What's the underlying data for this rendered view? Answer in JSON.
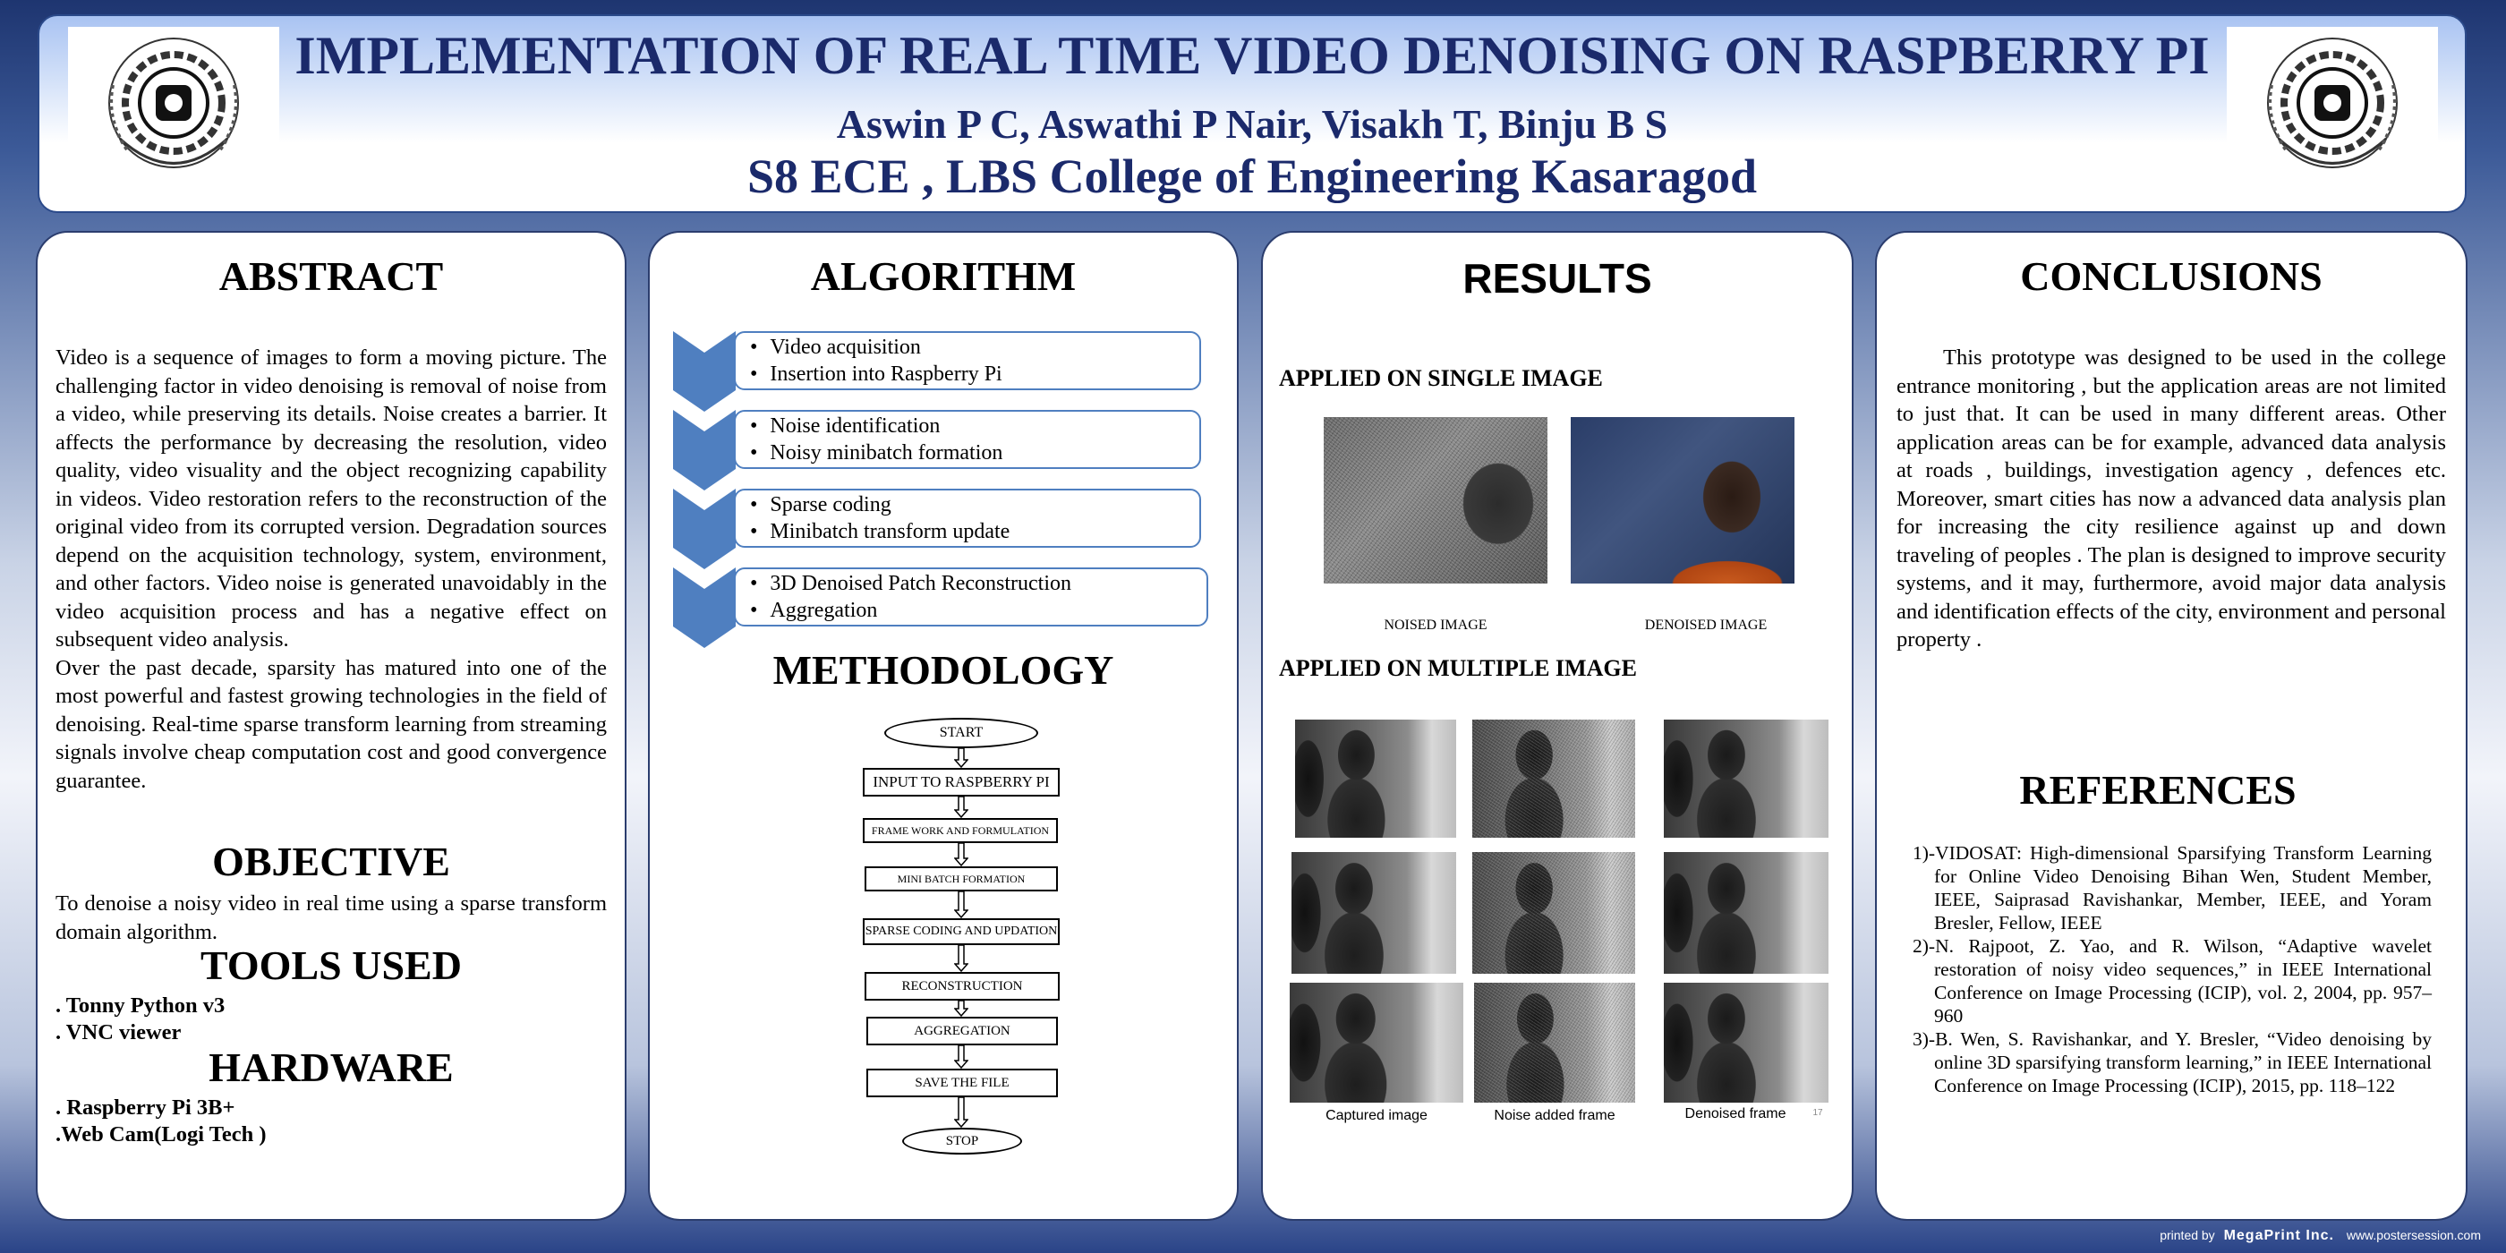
{
  "header": {
    "title": "IMPLEMENTATION OF REAL TIME VIDEO DENOISING ON RASPBERRY PI",
    "authors": "Aswin P C,  Aswathi P Nair, Visakh T,  Binju B S",
    "college": "S8 ECE , LBS College of Engineering Kasaragod"
  },
  "abstract": {
    "title": "ABSTRACT",
    "para1": "Video is a sequence of images to form a moving picture. The challenging factor in video denoising is removal of noise from a video, while preserving its details. Noise creates a barrier. It affects the performance by decreasing the resolution, video quality, video visuality and the object recognizing capability in videos. Video restoration refers to the reconstruction of the original video from its corrupted version. Degradation sources depend on the acquisition technology, system, environment, and other factors. Video noise is generated unavoidably in the video acquisition process and has a negative effect on subsequent video analysis.",
    "para2": "Over the past decade, sparsity has matured into one of the most powerful and fastest growing technologies in the field of denoising. Real-time sparse transform learning from streaming signals involve cheap computation cost and good convergence guarantee."
  },
  "objective": {
    "title": "OBJECTIVE",
    "text": "To denoise a noisy video in real time using a sparse transform domain algorithm."
  },
  "tools": {
    "title": "TOOLS USED",
    "items": [
      ". Tonny Python v3",
      ". VNC viewer"
    ]
  },
  "hardware": {
    "title": "HARDWARE",
    "items": [
      ". Raspberry Pi 3B+",
      ".Web Cam(Logi Tech )"
    ]
  },
  "algorithm": {
    "title": "ALGORITHM",
    "steps": [
      [
        "Video acquisition",
        "Insertion into Raspberry Pi"
      ],
      [
        "Noise identification",
        "Noisy minibatch formation"
      ],
      [
        "Sparse coding",
        "Minibatch transform update"
      ],
      [
        "3D Denoised Patch Reconstruction",
        "Aggregation"
      ]
    ],
    "color": "#4f7fc0"
  },
  "methodology": {
    "title": "METHODOLOGY",
    "flow": [
      "START",
      "INPUT TO RASPBERRY PI",
      "FRAME WORK AND FORMULATION",
      "MINI BATCH FORMATION",
      "SPARSE CODING AND UPDATION",
      "RECONSTRUCTION",
      "AGGREGATION",
      "SAVE THE FILE",
      "STOP"
    ]
  },
  "results": {
    "title": "RESULTS",
    "single_heading": "APPLIED ON SINGLE IMAGE",
    "single_captions": [
      "NOISED IMAGE",
      "DENOISED IMAGE"
    ],
    "multiple_heading": "APPLIED ON MULTIPLE IMAGE",
    "multiple_captions": [
      "Captured image",
      "Noise added frame",
      "Denoised frame"
    ],
    "slide_number": "17"
  },
  "conclusions": {
    "title": "CONCLUSIONS",
    "text": "This prototype was designed to be used in the college entrance monitoring , but the application areas are not limited to just that. It can be used in many different areas. Other application areas can be for example, advanced data analysis at roads , buildings, investigation agency , defences etc. Moreover, smart cities has now a advanced data analysis  plan for increasing the city resilience against up and down traveling of peoples . The plan is designed to improve security systems, and it may, furthermore, avoid major data analysis and identification effects of the city, environment and personal property ."
  },
  "references": {
    "title": "REFERENCES",
    "items": [
      "1)-VIDOSAT: High-dimensional Sparsifying Transform Learning for Online Video Denoising Bihan Wen, Student Member, IEEE, Saiprasad Ravishankar, Member, IEEE, and Yoram Bresler, Fellow, IEEE",
      "2)-N. Rajpoot, Z. Yao, and R. Wilson, “Adaptive wavelet restoration of noisy video sequences,” in IEEE International Conference on Image Processing (ICIP), vol. 2, 2004, pp. 957–960",
      "3)-B. Wen, S. Ravishankar, and Y. Bresler, “Video denoising by online 3D sparsifying transform learning,” in IEEE International Conference on Image Processing (ICIP), 2015, pp. 118–122"
    ]
  },
  "footer": {
    "printed_by": "printed by",
    "brand": "MegaPrint Inc.",
    "site": "www.postersession.com"
  }
}
